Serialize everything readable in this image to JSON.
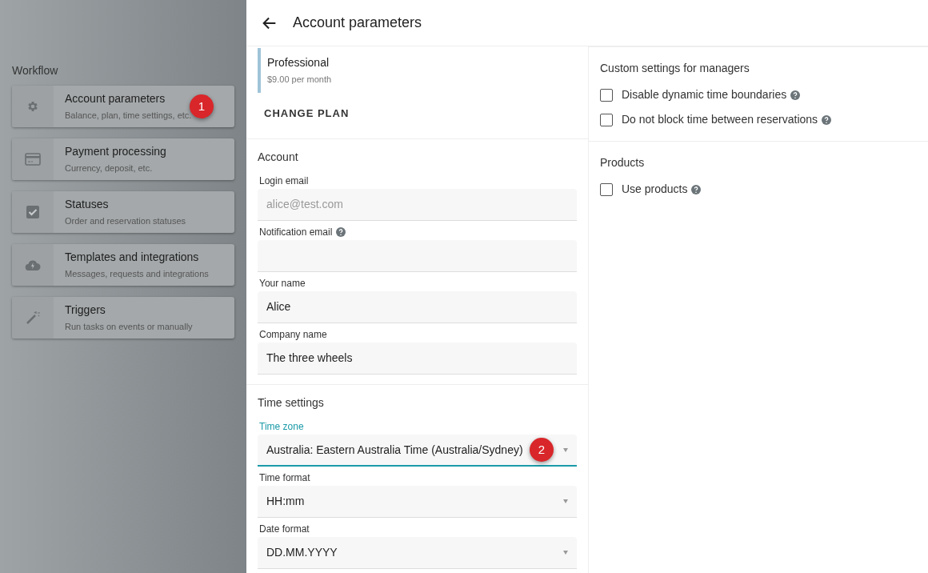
{
  "sidebar": {
    "heading": "Workflow",
    "items": [
      {
        "title": "Account parameters",
        "subtitle": "Balance, plan, time settings, etc.",
        "badge": "1"
      },
      {
        "title": "Payment processing",
        "subtitle": "Currency, deposit, etc."
      },
      {
        "title": "Statuses",
        "subtitle": "Order and reservation statuses"
      },
      {
        "title": "Templates and integrations",
        "subtitle": "Messages, requests and integrations"
      },
      {
        "title": "Triggers",
        "subtitle": "Run tasks on events or manually"
      }
    ]
  },
  "header": {
    "title": "Account parameters"
  },
  "plan": {
    "name": "Professional",
    "price": "$9.00 per month",
    "button": "CHANGE PLAN"
  },
  "sections": [
    {
      "title": "Account",
      "fields": [
        {
          "kind": "text",
          "label": "Login email",
          "value": "alice@test.com",
          "disabled": true,
          "help": false,
          "focused": false
        },
        {
          "kind": "text",
          "label": "Notification email",
          "help": true,
          "focused": false
        },
        {
          "kind": "text",
          "label": "Your name",
          "value": "Alice",
          "disabled": false,
          "help": false,
          "focused": false
        },
        {
          "kind": "text",
          "label": "Company name",
          "value": "The three wheels",
          "disabled": false,
          "help": false,
          "focused": false
        }
      ]
    },
    {
      "title": "Time settings",
      "fields": [
        {
          "kind": "select",
          "label": "Time zone",
          "value": "Australia: Eastern Australia Time (Australia/Sydney)",
          "disabled": false,
          "help": false,
          "focused": true,
          "badge": "2"
        },
        {
          "kind": "select",
          "label": "Time format",
          "value": "HH:mm",
          "disabled": false,
          "help": false,
          "focused": false
        },
        {
          "kind": "select",
          "label": "Date format",
          "value": "DD.MM.YYYY",
          "disabled": false,
          "help": false,
          "focused": false
        }
      ]
    }
  ],
  "right_sections": [
    {
      "title": "Custom settings for managers",
      "options": [
        {
          "label": "Disable dynamic time boundaries",
          "checked": false,
          "help": true
        },
        {
          "label": "Do not block time between reservations",
          "checked": false,
          "help": true
        }
      ]
    },
    {
      "title": "Products",
      "options": [
        {
          "label": "Use products",
          "checked": false,
          "help": true
        }
      ]
    }
  ]
}
